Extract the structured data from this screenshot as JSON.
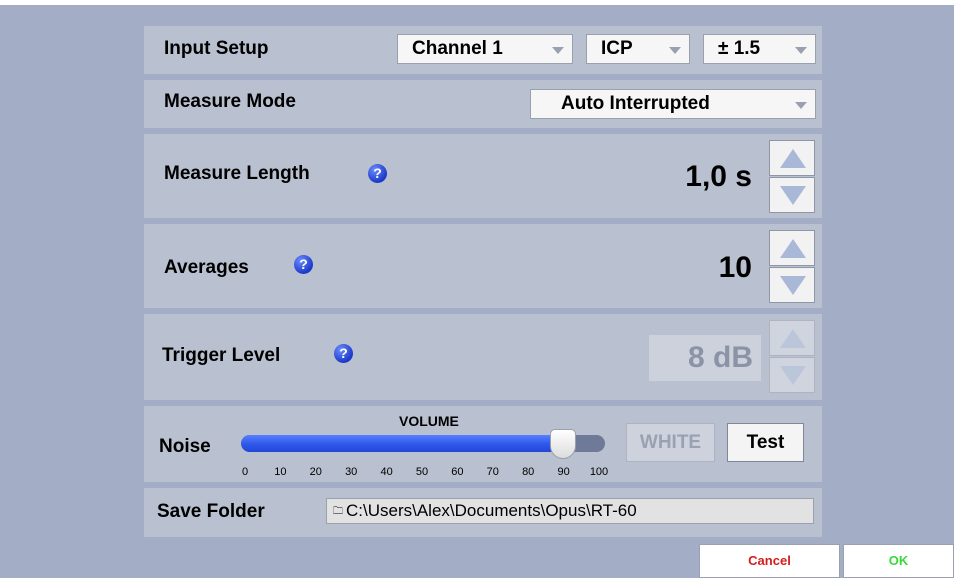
{
  "input_setup": {
    "label": "Input Setup",
    "channel": "Channel 1",
    "coupling": "ICP",
    "range": "± 1.5"
  },
  "measure_mode": {
    "label": "Measure Mode",
    "value": "Auto Interrupted"
  },
  "measure_length": {
    "label": "Measure Length",
    "value": "1,0 s",
    "help_glyph": "?"
  },
  "averages": {
    "label": "Averages",
    "value": "10",
    "help_glyph": "?"
  },
  "trigger_level": {
    "label": "Trigger Level",
    "value": "8 dB",
    "help_glyph": "?",
    "enabled": false
  },
  "noise": {
    "label": "Noise",
    "volume_label": "VOLUME",
    "volume_value": 90,
    "scale": [
      "0",
      "10",
      "20",
      "30",
      "40",
      "50",
      "60",
      "70",
      "80",
      "90",
      "100"
    ],
    "white_label": "WHITE",
    "test_label": "Test"
  },
  "save_folder": {
    "label": "Save Folder",
    "path": "C:\\Users\\Alex\\Documents\\Opus\\RT-60"
  },
  "footer": {
    "cancel_label": "Cancel",
    "ok_label": "OK"
  },
  "colors": {
    "background": "#a3adc6",
    "panel": "#b9c0cf",
    "slider_fill": "#2f57ea",
    "cancel_text": "#d41c1c",
    "ok_text": "#3ad83a"
  },
  "icons": {
    "help": "help-icon",
    "spin_up": "up-arrow-icon",
    "spin_down": "down-arrow-icon",
    "dropdown": "chevron-down-icon",
    "folder": "folder-icon"
  }
}
